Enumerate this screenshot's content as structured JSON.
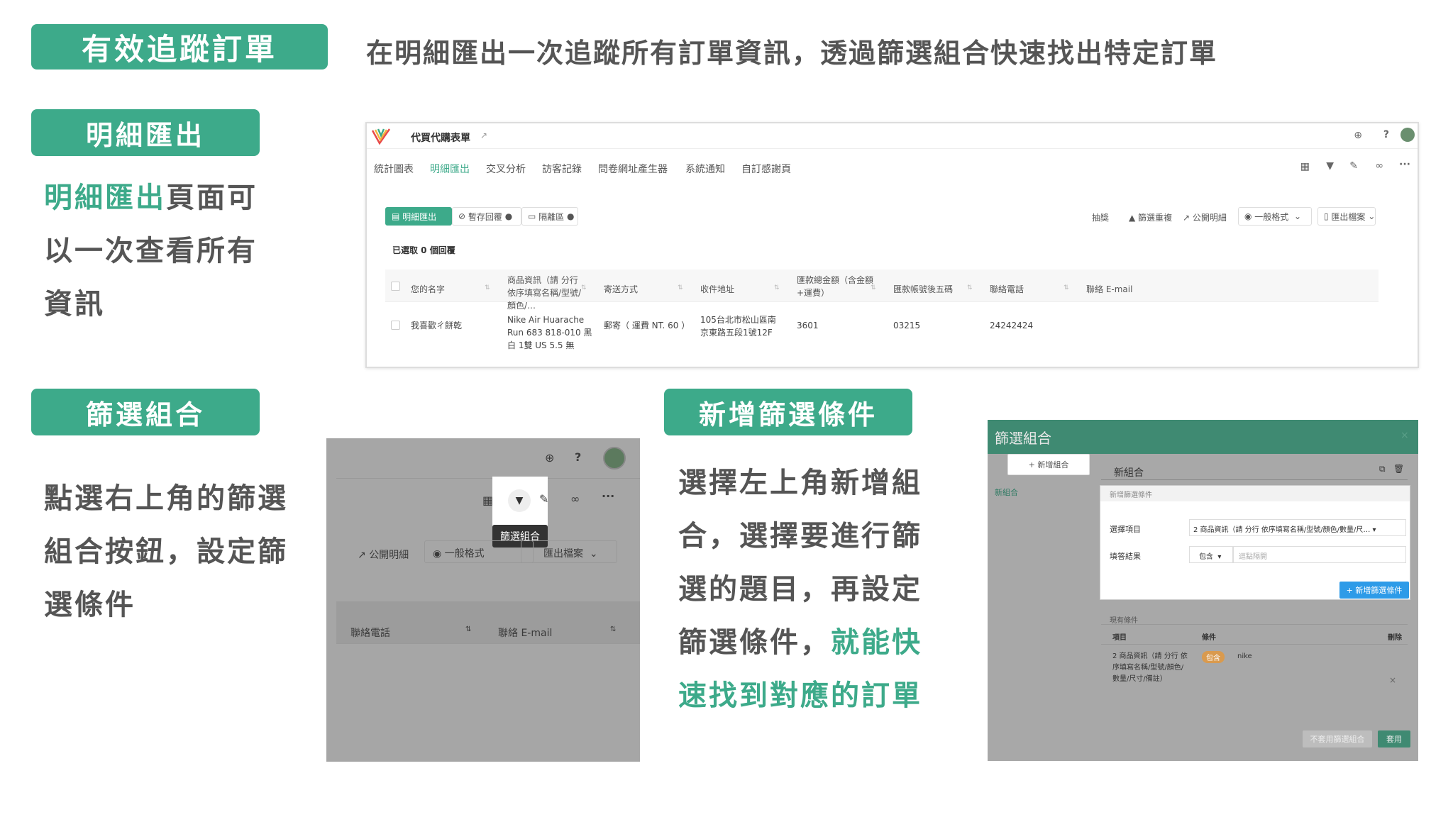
{
  "header": {
    "label": "有效追蹤訂單",
    "subtitle": "在明細匯出一次追蹤所有訂單資訊，透過篩選組合快速找出特定訂單"
  },
  "section_export": {
    "label": "明細匯出",
    "desc_highlight": "明細匯出",
    "desc_line1_rest": "頁面可",
    "desc_line2": "以一次查看所有",
    "desc_line3": "資訊"
  },
  "section_filter": {
    "label": "篩選組合",
    "desc_line1": "點選右上角的篩選",
    "desc_line2": "組合按鈕，設定篩",
    "desc_line3": "選條件"
  },
  "section_new_filter": {
    "label": "新增篩選條件",
    "desc_line1": "選擇左上角新增組",
    "desc_line2": "合，選擇要進行篩",
    "desc_line3": "選的題目，再設定",
    "desc_line4_plain": "篩選條件，",
    "desc_line4_hl": "就能快",
    "desc_line5_hl": "速找到對應的訂單"
  },
  "shot1": {
    "form_title": "代買代購表單",
    "nav": [
      "統計圖表",
      "明細匯出",
      "交叉分析",
      "訪客記錄",
      "問卷網址產生器",
      "系統通知",
      "自訂感謝頁"
    ],
    "buttons_left": [
      "明細匯出",
      "暫存回覆",
      "隔離區"
    ],
    "buttons_right": [
      "抽獎",
      "篩選重複",
      "公開明細",
      "一般格式",
      "匯出檔案"
    ],
    "selected_text": "已選取 0 個回覆",
    "columns": [
      "您的名字",
      "商品資訊（請 分行 依序填寫名稱/型號/顏色/…",
      "寄送方式",
      "收件地址",
      "匯款總金額（含金額+運費）",
      "匯款帳號後五碼",
      "聯絡電話",
      "聯絡 E-mail"
    ],
    "row": {
      "name": "我喜歡ㄔ餅乾",
      "product": "Nike Air Huarache Run 683 818-010 黑白 1雙 US 5.5 無",
      "shipping": "郵寄（ 運費 NT. 60 ）",
      "address": "105台北市松山區南京東路五段1號12F",
      "amount": "3601",
      "account": "03215",
      "phone": "24242424",
      "email": ""
    }
  },
  "shot2": {
    "tooltip": "篩選組合",
    "btn_public": "公開明細",
    "btn_format": "一般格式",
    "btn_export": "匯出檔案",
    "col_phone": "聯絡電話",
    "col_email": "聯絡 E-mail"
  },
  "shot3": {
    "title": "篩選組合",
    "add_group": "+ 新增組合",
    "sidebar_item": "新組合",
    "group_name": "新組合",
    "new_condition_header": "新增篩選條件",
    "select_item_label": "選擇項目",
    "select_item_value": "2 商品資訊（請 分行 依序填寫名稱/型號/顏色/數量/尺…",
    "answer_label": "填答結果",
    "op_value": "包含",
    "answer_placeholder": "逗點隔開",
    "add_condition_btn": "+ 新增篩選條件",
    "current_header": "現有條件",
    "col_item": "項目",
    "col_condition": "條件",
    "col_delete": "刪除",
    "cond_item": "2 商品資訊（請 分行 依序填寫名稱/型號/顏色/數量/尺寸/備註）",
    "cond_op": "包含",
    "cond_value": "nike",
    "btn_no_apply": "不套用篩選組合",
    "btn_apply": "套用"
  }
}
